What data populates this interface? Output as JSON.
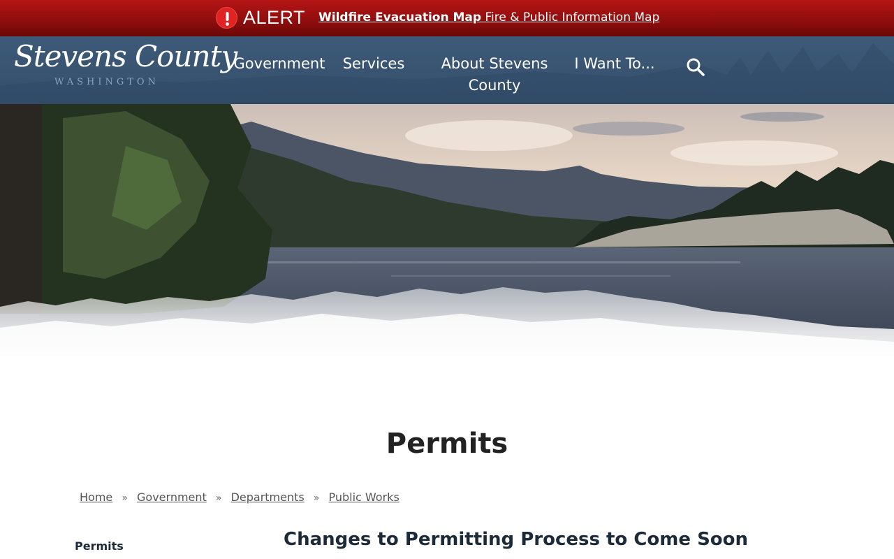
{
  "alert": {
    "icon": "exclamation-circle-icon",
    "label": "ALERT",
    "link_bold": "Wildfire Evacuation Map",
    "link_rest": " Fire & Public Information Map",
    "color": "#a31212"
  },
  "header": {
    "logo_title": "Stevens County",
    "logo_subtitle": "WASHINGTON",
    "nav": [
      {
        "label": "Government"
      },
      {
        "label": "Services"
      },
      {
        "label": "About Stevens County"
      },
      {
        "label": "I Want To..."
      }
    ],
    "search_icon": "search-icon",
    "color": "#3b5775"
  },
  "hero": {
    "image": "lake-mountains-landscape"
  },
  "page": {
    "title": "Permits",
    "breadcrumb": [
      {
        "label": "Home"
      },
      {
        "label": "Government"
      },
      {
        "label": "Departments"
      },
      {
        "label": "Public Works"
      }
    ],
    "breadcrumb_separator": "»",
    "sidebar_heading": "Permits",
    "article_heading": "Changes to Permitting Process to Come Soon"
  }
}
